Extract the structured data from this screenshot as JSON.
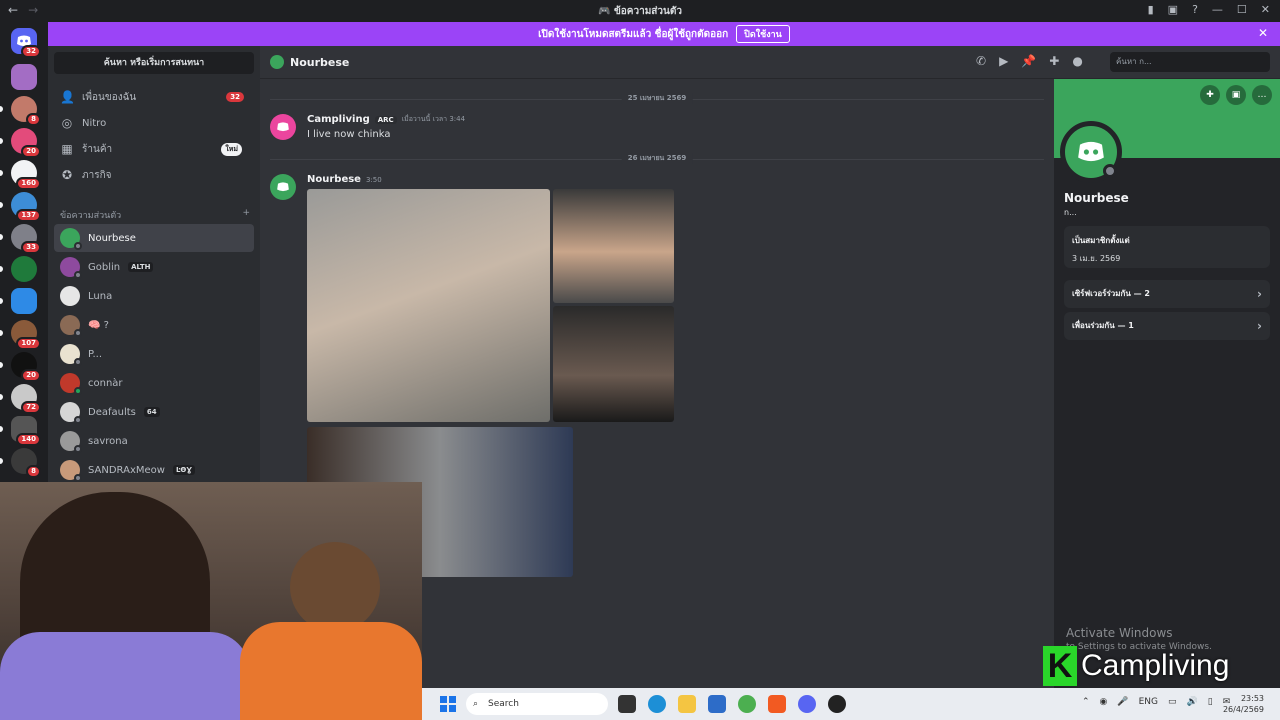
{
  "window": {
    "title": "ข้อความส่วนตัว"
  },
  "banner": {
    "text": "เปิดใช้งานโหมดสตรีมแล้ว ชื่อผู้ใช้ถูกตัดออก",
    "button": "ปิดใช้งาน"
  },
  "rail": {
    "home_badge": "32",
    "servers": [
      {
        "badge": ""
      },
      {
        "badge": "8"
      },
      {
        "badge": "20"
      },
      {
        "badge": "160"
      },
      {
        "badge": "137"
      },
      {
        "badge": "33"
      },
      {
        "badge": ""
      },
      {
        "badge": ""
      },
      {
        "badge": "107"
      },
      {
        "badge": "20"
      },
      {
        "badge": "72"
      },
      {
        "badge": "140"
      },
      {
        "badge": "8"
      }
    ]
  },
  "dm_sidebar": {
    "search": "ค้นหา หรือเริ่มการสนทนา",
    "nav": [
      {
        "label": "เพื่อนของฉัน",
        "count": "32"
      },
      {
        "label": "Nitro"
      },
      {
        "label": "ร้านค้า",
        "new": "ใหม่"
      },
      {
        "label": "ภารกิจ"
      }
    ],
    "section_title": "ข้อความส่วนตัว",
    "dms": [
      {
        "name": "Nourbese",
        "tag": ""
      },
      {
        "name": "Goblin",
        "tag": "ALTH"
      },
      {
        "name": "Luna",
        "tag": ""
      },
      {
        "name": "🧠 ?",
        "tag": ""
      },
      {
        "name": "P...",
        "tag": ""
      },
      {
        "name": "connàr",
        "tag": ""
      },
      {
        "name": "Deafaults",
        "tag": "64"
      },
      {
        "name": "savrona",
        "tag": ""
      },
      {
        "name": "SANDRAxMeow",
        "tag": "ĿƟƔ"
      }
    ]
  },
  "chat": {
    "header_name": "Nourbese",
    "header_search": "ค้นหา ก...",
    "date_dividers": [
      "25 เมษายน 2569",
      "26 เมษายน 2569"
    ],
    "messages": [
      {
        "author": "Campliving",
        "badge": "ARC",
        "time": "เมื่อวานนี้ เวลา 3:44",
        "text": "I live now chinka"
      },
      {
        "author": "Nourbese",
        "time": "3:50",
        "text": ""
      }
    ]
  },
  "profile": {
    "name": "Nourbese",
    "username": "n...",
    "member_since_label": "เป็นสมาชิกตั้งแต่",
    "member_since": "3 เม.ย. 2569",
    "mutual_servers": "เซิร์ฟเวอร์ร่วมกัน — 2",
    "mutual_friends": "เพื่อนร่วมกัน — 1"
  },
  "overlay": {
    "activate_title": "Activate Windows",
    "activate_sub": "to Settings to activate Windows.",
    "logo_letter": "K",
    "logo_text": "Campliving"
  },
  "taskbar": {
    "search": "Search",
    "lang": "ENG",
    "time": "23:53",
    "date": "26/4/2569"
  },
  "colors": {
    "accent": "#9b44f7",
    "discord_green": "#3ba55c",
    "badge_red": "#da373c"
  }
}
